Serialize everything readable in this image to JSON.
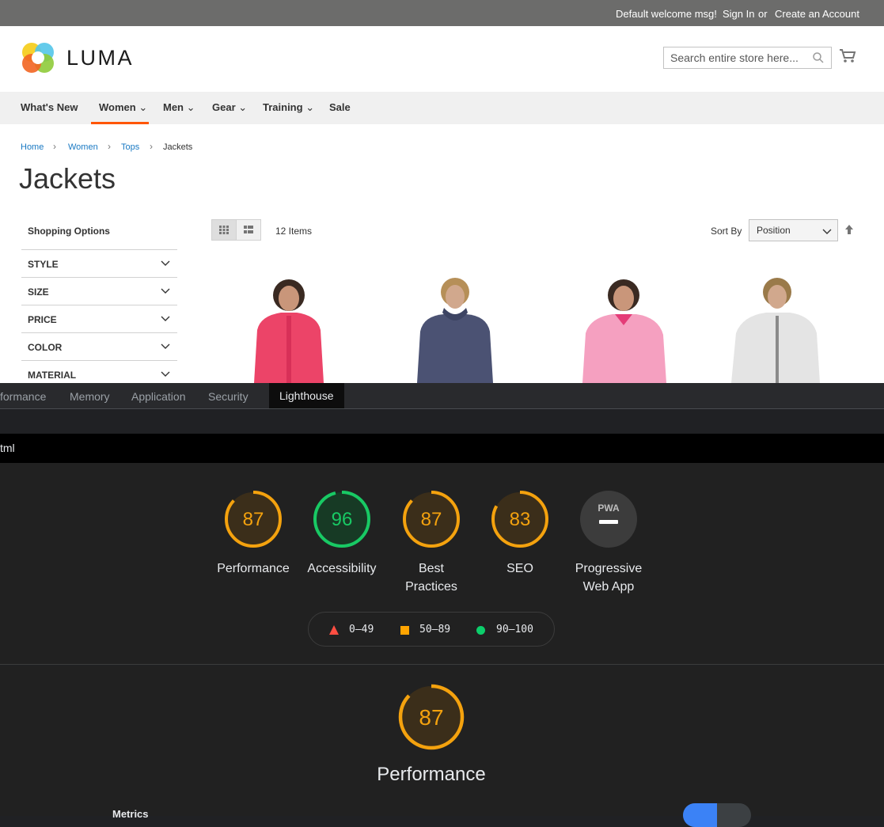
{
  "store": {
    "welcome": "Default welcome msg!",
    "sign_in": "Sign In",
    "or": "or",
    "create_account": "Create an Account",
    "logo_text": "LUMA",
    "search_placeholder": "Search entire store here...",
    "nav": [
      "What's New",
      "Women",
      "Men",
      "Gear",
      "Training",
      "Sale"
    ],
    "breadcrumb": [
      "Home",
      "Women",
      "Tops",
      "Jackets"
    ],
    "page_title": "Jackets",
    "shopping_options": "Shopping Options",
    "filters": [
      "STYLE",
      "SIZE",
      "PRICE",
      "COLOR",
      "MATERIAL"
    ],
    "item_count": "12 Items",
    "sort_by_label": "Sort By",
    "sort_value": "Position",
    "accent_color": "#ff5501",
    "link_color": "#1979c3"
  },
  "devtools": {
    "tabs": [
      "formance",
      "Memory",
      "Application",
      "Security",
      "Lighthouse"
    ],
    "active_tab": "Lighthouse",
    "url_fragment": "tml",
    "gauges": [
      {
        "score": "87",
        "label": "Performance",
        "color": "#f4a20e"
      },
      {
        "score": "96",
        "label": "Accessibility",
        "color": "#18c964"
      },
      {
        "score": "87",
        "label_line1": "Best",
        "label_line2": "Practices",
        "color": "#f4a20e"
      },
      {
        "score": "83",
        "label": "SEO",
        "color": "#f4a20e"
      },
      {
        "badge": "PWA",
        "label_line1": "Progressive",
        "label_line2": "Web App"
      }
    ],
    "legend": {
      "fail": "0–49",
      "average": "50–89",
      "pass": "90–100",
      "fail_color": "#ff4e42",
      "average_color": "#ffa400",
      "pass_color": "#0cce6b"
    },
    "performance": {
      "score": "87",
      "title": "Performance",
      "metrics_label": "Metrics"
    }
  }
}
